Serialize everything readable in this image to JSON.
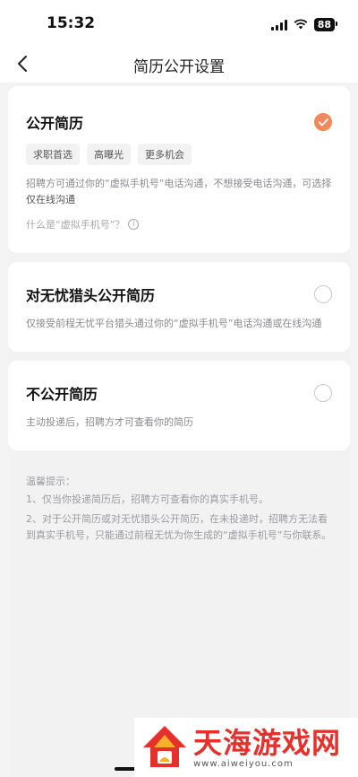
{
  "status_bar": {
    "time": "15:32",
    "battery": "88"
  },
  "nav": {
    "title": "简历公开设置"
  },
  "options": [
    {
      "title": "公开简历",
      "selected": true,
      "tags": [
        "求职首选",
        "高曝光",
        "更多机会"
      ],
      "desc": "招聘方可通过你的“虚拟手机号”电话沟通，不想接受电话沟通，可选择",
      "desc_em": "仅在线沟通",
      "help": "什么是“虚拟手机号”？"
    },
    {
      "title": "对无忧猎头公开简历",
      "selected": false,
      "desc": "仅接受前程无忧平台猎头通过你的“虚拟手机号”电话沟通或在线沟通"
    },
    {
      "title": "不公开简历",
      "selected": false,
      "desc": "主动投递后，招聘方才可查看你的简历"
    }
  ],
  "tips": {
    "title": "温馨提示：",
    "lines": [
      "1、仅当你投递简历后，招聘方可查看你的真实手机号。",
      "2、对于公开简历或对无忧猎头公开简历，在未投递时，招聘方无法看到真实手机号，只能通过前程无忧为你生成的“虚拟手机号”与你联系。"
    ]
  },
  "watermark": {
    "name": "天海游戏网",
    "url": "www.aiweiyou.com"
  },
  "colors": {
    "accent": "#f08a5d",
    "watermark_red": "#e4312b"
  },
  "icons": {
    "back": "chevron-left-icon",
    "check": "check-icon",
    "info": "info-icon"
  }
}
